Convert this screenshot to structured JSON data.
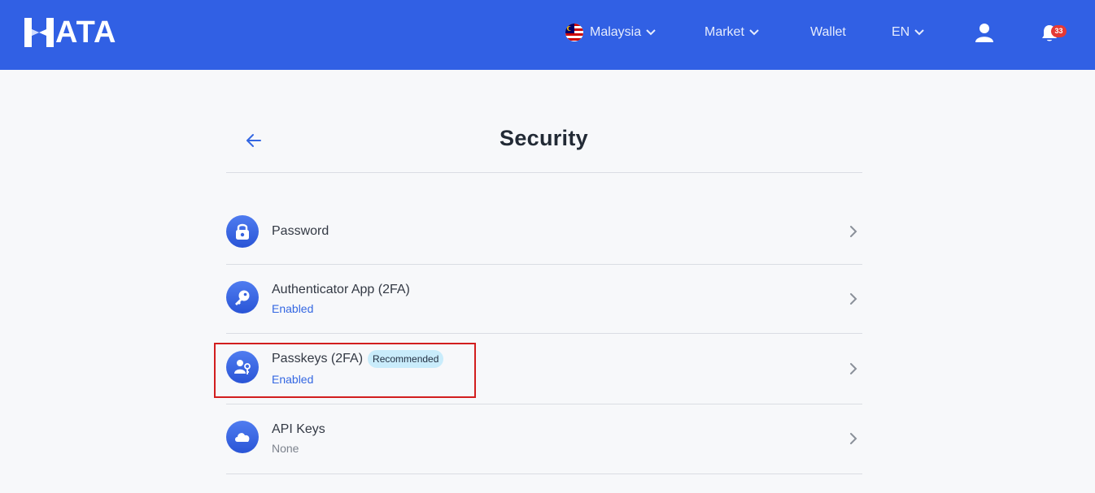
{
  "header": {
    "logo_text": "ATA",
    "nav": {
      "country": "Malaysia",
      "market": "Market",
      "wallet": "Wallet",
      "language": "EN"
    },
    "notification_count": "33"
  },
  "page": {
    "title": "Security"
  },
  "items": [
    {
      "title": "Password",
      "icon": "lock-icon"
    },
    {
      "title": "Authenticator App (2FA)",
      "status": "Enabled",
      "icon": "key-icon"
    },
    {
      "title": "Passkeys (2FA)",
      "badge": "Recommended",
      "status": "Enabled",
      "icon": "user-key-icon"
    },
    {
      "title": "API Keys",
      "status": "None",
      "icon": "cloud-icon"
    }
  ],
  "colors": {
    "header_bg": "#3160e4",
    "accent": "#3467e2",
    "badge_bg": "#c9ecfb",
    "notification_badge": "#e53935",
    "highlight_border": "#d21e1e"
  }
}
